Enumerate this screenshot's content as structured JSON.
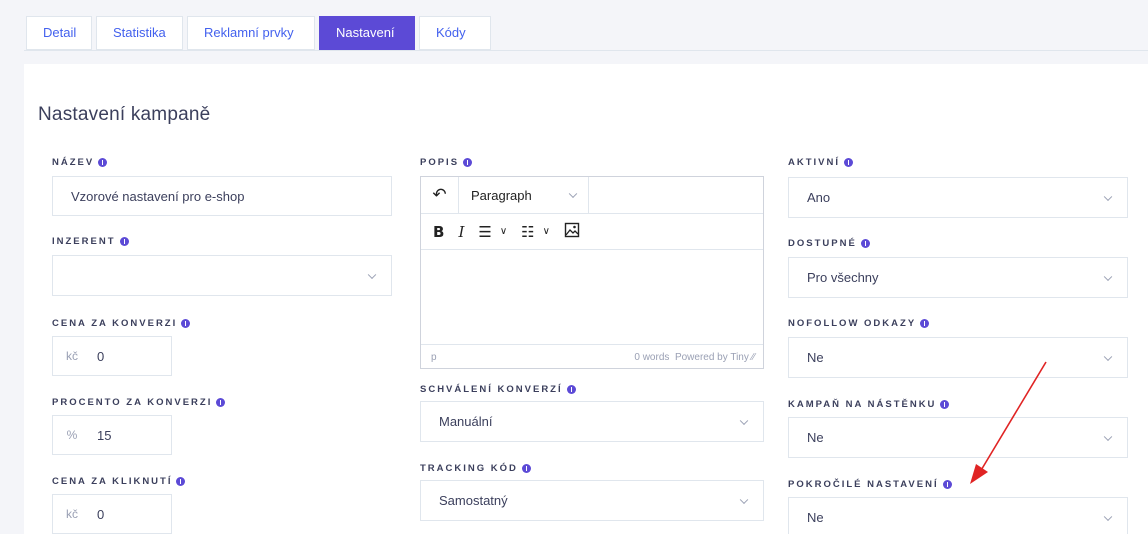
{
  "tabs": [
    {
      "label": "Detail"
    },
    {
      "label": "Statistika"
    },
    {
      "label": "Reklamní prvky"
    },
    {
      "label": "Nastavení"
    },
    {
      "label": "Kódy"
    }
  ],
  "active_tab": "Nastavení",
  "page": {
    "title": "Nastavení kampaně"
  },
  "form": {
    "nazev": {
      "label": "NÁZEV",
      "value": "Vzorové nastavení pro e-shop"
    },
    "inzerent": {
      "label": "INZERENT",
      "value": ""
    },
    "cena_konverze": {
      "label": "CENA ZA KONVERZI",
      "prefix": "kč",
      "value": "0"
    },
    "procento_konverze": {
      "label": "PROCENTO ZA KONVERZI",
      "prefix": "%",
      "value": "15"
    },
    "cena_kliknuti": {
      "label": "CENA ZA KLIKNUTÍ",
      "prefix": "kč",
      "value": "0"
    },
    "popis": {
      "label": "POPIS",
      "format_select": "Paragraph",
      "status_path": "p",
      "status_words": "0 words",
      "status_powered": "Powered by Tiny"
    },
    "schvaleni": {
      "label": "SCHVÁLENÍ KONVERZÍ",
      "value": "Manuální"
    },
    "tracking": {
      "label": "TRACKING KÓD",
      "value": "Samostatný"
    },
    "aktivni": {
      "label": "AKTIVNÍ",
      "value": "Ano"
    },
    "dostupne": {
      "label": "DOSTUPNÉ",
      "value": "Pro všechny"
    },
    "nofollow": {
      "label": "NOFOLLOW ODKAZY",
      "value": "Ne"
    },
    "nastenka": {
      "label": "KAMPAŇ NA NÁSTĚNKU",
      "value": "Ne"
    },
    "pokrocile": {
      "label": "POKROČILÉ NASTAVENÍ",
      "value": "Ne"
    }
  },
  "colors": {
    "accent": "#5c4ad6",
    "link": "#4361ee",
    "annotation_arrow": "#e02424"
  },
  "icons": {
    "undo": "undo-icon",
    "bold": "bold-icon",
    "italic": "italic-icon",
    "bullet_list": "bullet-list-icon",
    "numbered_list": "numbered-list-icon",
    "image": "image-icon",
    "info": "info-icon",
    "chevron": "chevron-down-icon",
    "arrow": "red-arrow-annotation"
  }
}
